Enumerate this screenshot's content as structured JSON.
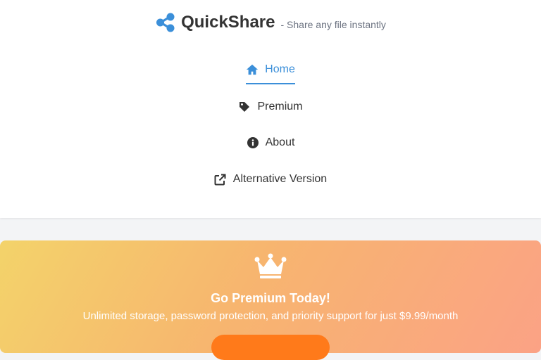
{
  "header": {
    "brand_name": "QuickShare",
    "tagline": "- Share any file instantly",
    "brand_icon": "share-icon",
    "accent_color": "#3b8fd9"
  },
  "nav": {
    "items": [
      {
        "label": "Home",
        "icon": "home-icon",
        "active": true
      },
      {
        "label": "Premium",
        "icon": "tag-icon",
        "active": false
      },
      {
        "label": "About",
        "icon": "info-icon",
        "active": false
      },
      {
        "label": "Alternative Version",
        "icon": "external-link-icon",
        "active": false
      }
    ]
  },
  "premium": {
    "icon": "crown-icon",
    "title": "Go Premium Today!",
    "subtitle": "Unlimited storage, password protection, and priority support for just $9.99/month",
    "button_color": "#ff7a1a"
  }
}
